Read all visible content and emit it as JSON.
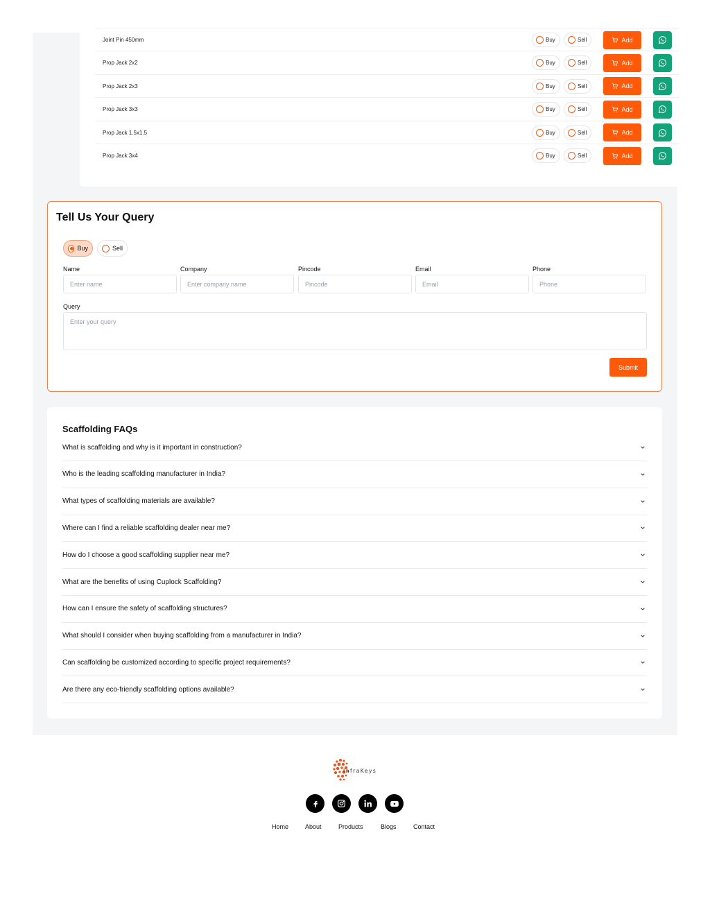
{
  "products": [
    {
      "name": "Joint Pin 450mm"
    },
    {
      "name": "Prop Jack 2x2"
    },
    {
      "name": "Prop Jack 2x3"
    },
    {
      "name": "Prop Jack 3x3"
    },
    {
      "name": "Prop Jack 1.5x1.5"
    },
    {
      "name": "Prop Jack 3x4"
    }
  ],
  "product_actions": {
    "buy_label": "Buy",
    "sell_label": "Sell",
    "add_label": "Add"
  },
  "query": {
    "title": "Tell Us Your Query",
    "buy_label": "Buy",
    "sell_label": "Sell",
    "selected": "Buy",
    "fields": [
      {
        "label": "Name",
        "placeholder": "Enter name"
      },
      {
        "label": "Company",
        "placeholder": "Enter company name"
      },
      {
        "label": "Pincode",
        "placeholder": "Pincode"
      },
      {
        "label": "Email",
        "placeholder": "Email"
      },
      {
        "label": "Phone",
        "placeholder": "Phone"
      }
    ],
    "query_label": "Query",
    "query_placeholder": "Enter your query",
    "submit_label": "Submit"
  },
  "faq": {
    "title": "Scaffolding FAQs",
    "items": [
      "What is scaffolding and why is it important in construction?",
      "Who is the leading scaffolding manufacturer in India?",
      "What types of scaffolding materials are available?",
      "Where can I find a reliable scaffolding dealer near me?",
      "How do I choose a good scaffolding supplier near me?",
      "What are the benefits of using Cuplock Scaffolding?",
      "How can I ensure the safety of scaffolding structures?",
      "What should I consider when buying scaffolding from a manufacturer in India?",
      "Can scaffolding be customized according to specific project requirements?",
      "Are there any eco-friendly scaffolding options available?"
    ]
  },
  "footer": {
    "logo_text": "InfraKeys",
    "social": [
      "facebook-icon",
      "instagram-icon",
      "linkedin-icon",
      "youtube-icon"
    ],
    "nav": [
      "Home",
      "About",
      "Products",
      "Blogs",
      "Contact"
    ]
  },
  "colors": {
    "accent": "#ff5a0a",
    "whatsapp": "#13a37a",
    "border_accent": "#f0824a"
  }
}
